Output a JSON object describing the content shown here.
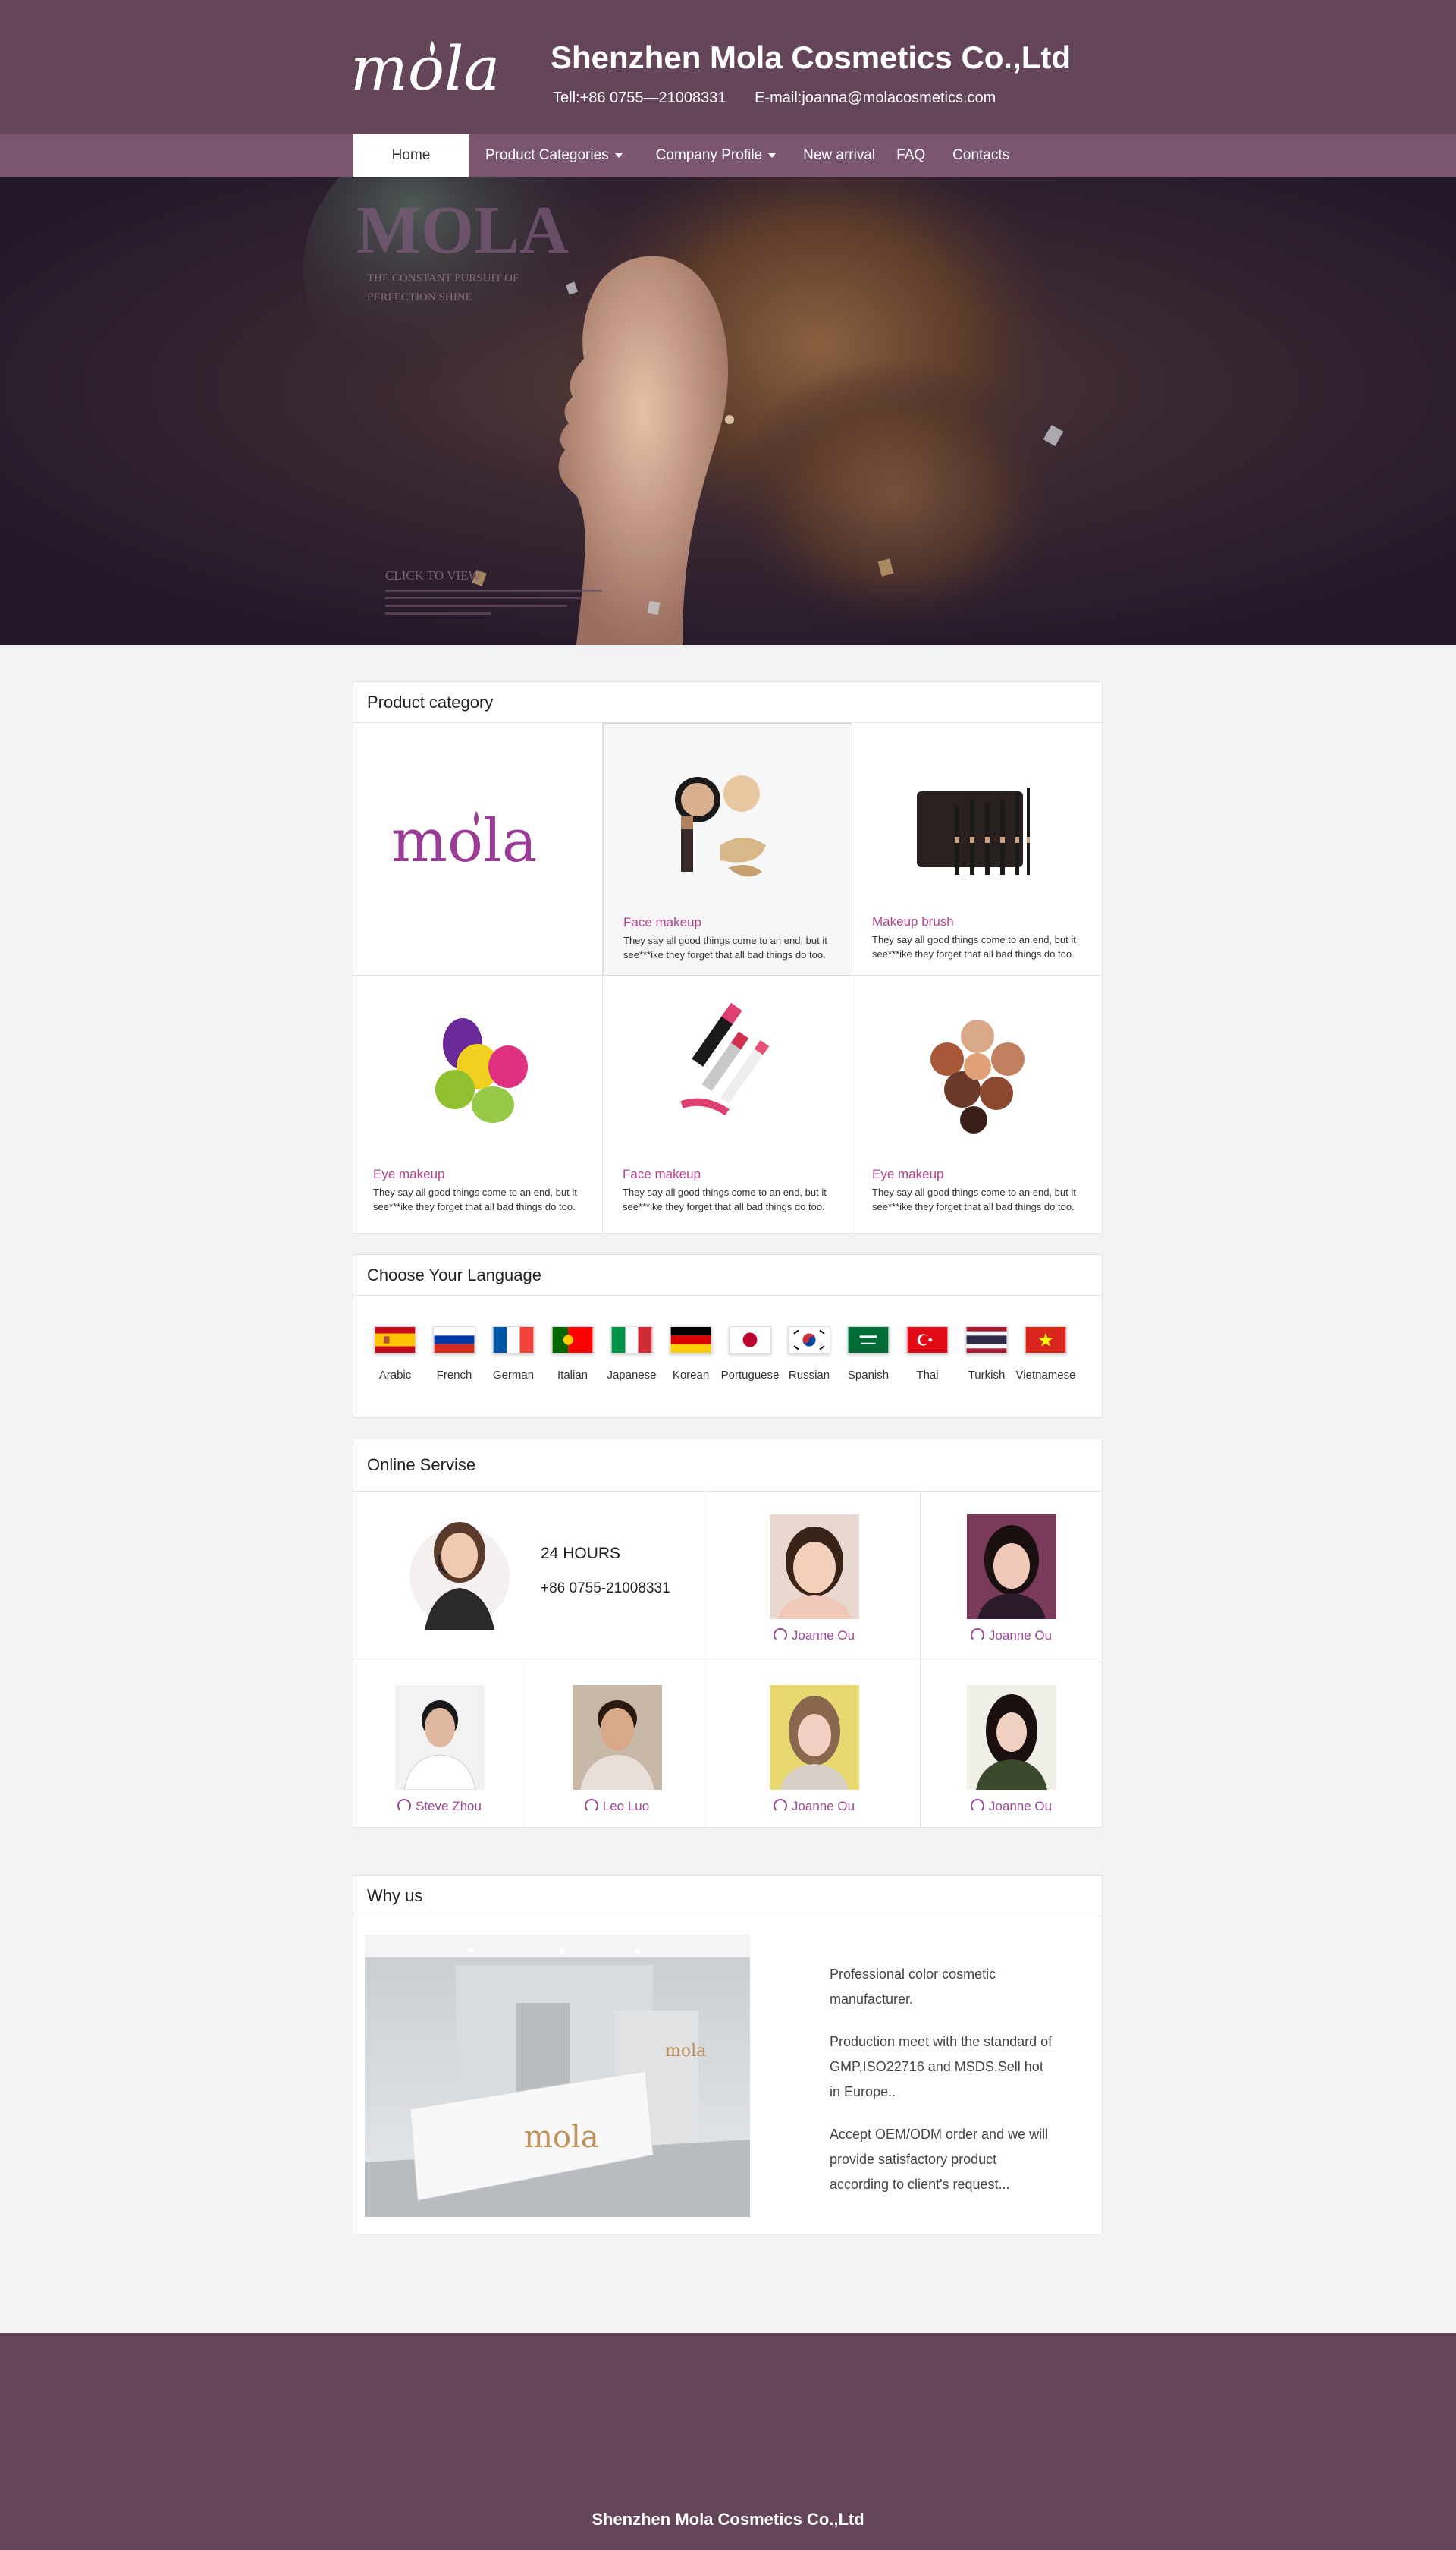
{
  "header": {
    "logo_text": "mola",
    "company_name": "Shenzhen Mola Cosmetics Co.,Ltd",
    "tel": "Tell:+86 0755—21008331",
    "email": "E-mail:joanna@molacosmetics.com"
  },
  "nav": {
    "items": [
      {
        "label": "Home",
        "active": true
      },
      {
        "label": "Product Categories",
        "dropdown": true
      },
      {
        "label": "Company Profile",
        "dropdown": true
      },
      {
        "label": "New arrival"
      },
      {
        "label": "FAQ"
      },
      {
        "label": "Contacts"
      }
    ]
  },
  "banner": {
    "brand": "MOLA",
    "tagline_1": "THE CONSTANT PURSUIT OF",
    "tagline_2": "PERFECTION SHINE",
    "cta": "CLICK TO VIEW"
  },
  "product_category": {
    "title": "Product category",
    "logo_text": "mola",
    "items": [
      {
        "name": "Face makeup",
        "desc": "They say all good things come to an end, but it see***ike they forget that all bad things do too.",
        "icon": "foundation-icon"
      },
      {
        "name": "Makeup brush",
        "desc": "They say all good things come to an end, but it see***ike they forget that all bad things do too.",
        "icon": "brush-set-icon"
      },
      {
        "name": "Eye makeup",
        "desc": "They say all good things come to an end, but it see***ike they forget that all bad things do too.",
        "icon": "sponge-icon"
      },
      {
        "name": "Face makeup",
        "desc": "They say all good things come to an end, but it see***ike they forget that all bad things do too.",
        "icon": "lipstick-icon"
      },
      {
        "name": "Eye makeup",
        "desc": "They say all good things come to an end, but it see***ike they forget that all bad things do too.",
        "icon": "powder-icon"
      }
    ]
  },
  "languages": {
    "title": "Choose Your Language",
    "items": [
      {
        "name": "Arabic",
        "flag": "spain"
      },
      {
        "name": "French",
        "flag": "russia"
      },
      {
        "name": "German",
        "flag": "france"
      },
      {
        "name": "Italian",
        "flag": "portugal"
      },
      {
        "name": "Japanese",
        "flag": "italy"
      },
      {
        "name": "Korean",
        "flag": "germany"
      },
      {
        "name": "Portuguese",
        "flag": "japan"
      },
      {
        "name": "Russian",
        "flag": "korea"
      },
      {
        "name": "Spanish",
        "flag": "saudi"
      },
      {
        "name": "Thai",
        "flag": "turkey"
      },
      {
        "name": "Turkish",
        "flag": "thailand"
      },
      {
        "name": "Vietnamese",
        "flag": "vietnam"
      }
    ]
  },
  "online_service": {
    "title": "Online Servise",
    "hours": "24 HOURS",
    "phone": "+86 0755-21008331",
    "agents": [
      {
        "name": "Joanne Ou"
      },
      {
        "name": "Joanne Ou"
      },
      {
        "name": "Steve Zhou"
      },
      {
        "name": "Leo Luo"
      },
      {
        "name": "Joanne Ou"
      },
      {
        "name": "Joanne Ou"
      }
    ]
  },
  "why_us": {
    "title": "Why us",
    "paragraphs": [
      "Professional color cosmetic manufacturer.",
      "Production meet with the standard of GMP,ISO22716 and MSDS.Sell hot in Europe..",
      "Accept OEM/ODM order and we will provide satisfactory product according to client's request..."
    ]
  },
  "footer": {
    "text": "Shenzhen Mola Cosmetics Co.,Ltd"
  },
  "colors": {
    "brand": "#654559",
    "nav": "#7a5670",
    "accent": "#b04590"
  }
}
